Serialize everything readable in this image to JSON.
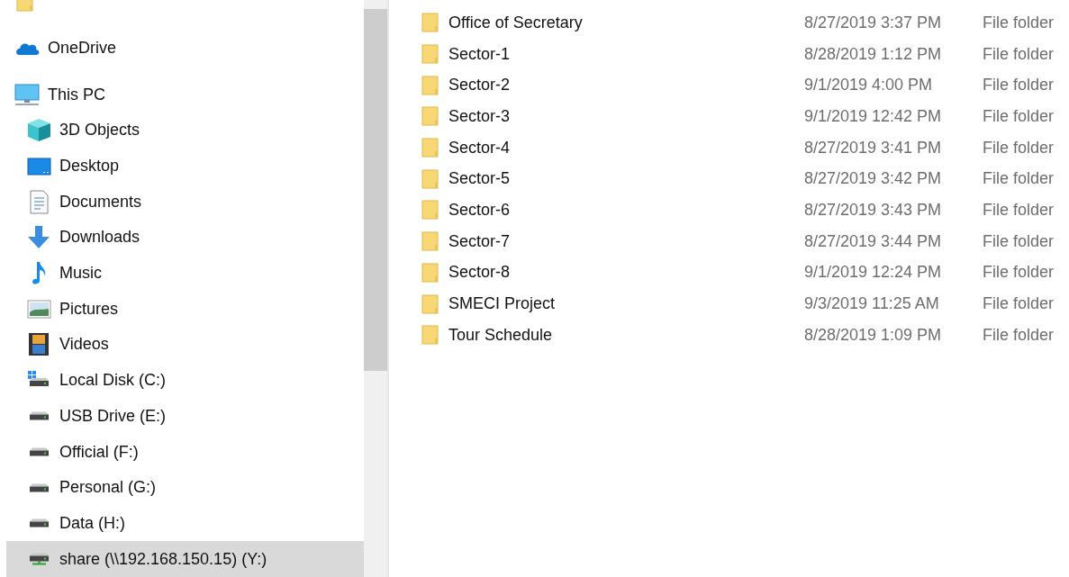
{
  "nav_pane": {
    "items": [
      {
        "kind": "folder"
      },
      {
        "kind": "cloud",
        "label": "OneDrive",
        "selected": false
      },
      {
        "kind": "pc",
        "label": "This PC",
        "selected": false,
        "children": [
          {
            "kind": "cube",
            "label": "3D Objects",
            "selected": false
          },
          {
            "kind": "desktop",
            "label": "Desktop",
            "selected": false
          },
          {
            "kind": "documents",
            "label": "Documents",
            "selected": false
          },
          {
            "kind": "downloads",
            "label": "Downloads",
            "selected": false
          },
          {
            "kind": "music",
            "label": "Music",
            "selected": false
          },
          {
            "kind": "pictures",
            "label": "Pictures",
            "selected": false
          },
          {
            "kind": "videos",
            "label": "Videos",
            "selected": false
          },
          {
            "kind": "system-drive",
            "label": "Local Disk (C:)",
            "selected": false
          },
          {
            "kind": "drive",
            "label": "USB Drive (E:)",
            "selected": false
          },
          {
            "kind": "drive",
            "label": "Official (F:)",
            "selected": false
          },
          {
            "kind": "drive",
            "label": "Personal (G:)",
            "selected": false
          },
          {
            "kind": "drive",
            "label": "Data (H:)",
            "selected": false
          },
          {
            "kind": "network-drive",
            "label": "share (\\\\192.168.150.15) (Y:)",
            "selected": true
          }
        ]
      }
    ]
  },
  "files": [
    {
      "name": "Office of Secretary",
      "date_modified": "8/27/2019 3:37 PM",
      "type": "File folder"
    },
    {
      "name": "Sector-1",
      "date_modified": "8/28/2019 1:12 PM",
      "type": "File folder"
    },
    {
      "name": "Sector-2",
      "date_modified": "9/1/2019 4:00 PM",
      "type": "File folder"
    },
    {
      "name": "Sector-3",
      "date_modified": "9/1/2019 12:42 PM",
      "type": "File folder"
    },
    {
      "name": "Sector-4",
      "date_modified": "8/27/2019 3:41 PM",
      "type": "File folder"
    },
    {
      "name": "Sector-5",
      "date_modified": "8/27/2019 3:42 PM",
      "type": "File folder"
    },
    {
      "name": "Sector-6",
      "date_modified": "8/27/2019 3:43 PM",
      "type": "File folder"
    },
    {
      "name": "Sector-7",
      "date_modified": "8/27/2019 3:44 PM",
      "type": "File folder"
    },
    {
      "name": "Sector-8",
      "date_modified": "9/1/2019 12:24 PM",
      "type": "File folder"
    },
    {
      "name": "SMECI Project",
      "date_modified": "9/3/2019 11:25 AM",
      "type": "File folder"
    },
    {
      "name": "Tour Schedule",
      "date_modified": "8/28/2019 1:09 PM",
      "type": "File folder"
    }
  ]
}
